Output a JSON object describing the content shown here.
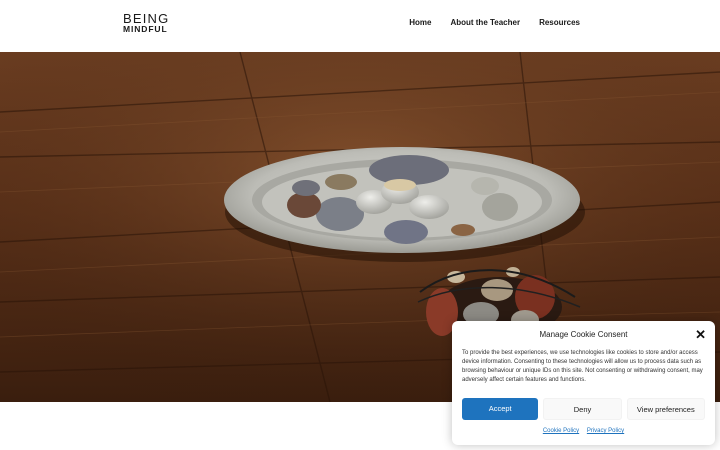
{
  "header": {
    "logo_top": "BEING",
    "logo_bottom": "MINDFUL",
    "nav": [
      {
        "label": "Home"
      },
      {
        "label": "About the Teacher"
      },
      {
        "label": "Resources"
      }
    ]
  },
  "cookie": {
    "title": "Manage Cookie Consent",
    "close_icon": "close-icon",
    "text": "To provide the best experiences, we use technologies like cookies to store and/or access device information. Consenting to these technologies will allow us to process data such as browsing behaviour or unique IDs on this site. Not consenting or withdrawing consent, may adversely affect certain features and functions.",
    "accept_label": "Accept",
    "deny_label": "Deny",
    "view_label": "View preferences",
    "cookie_policy_label": "Cookie Policy",
    "privacy_policy_label": "Privacy Policy"
  },
  "colors": {
    "accent": "#1e73be",
    "wood_dark": "#3b1f10",
    "wood_light": "#7a4a2a"
  }
}
